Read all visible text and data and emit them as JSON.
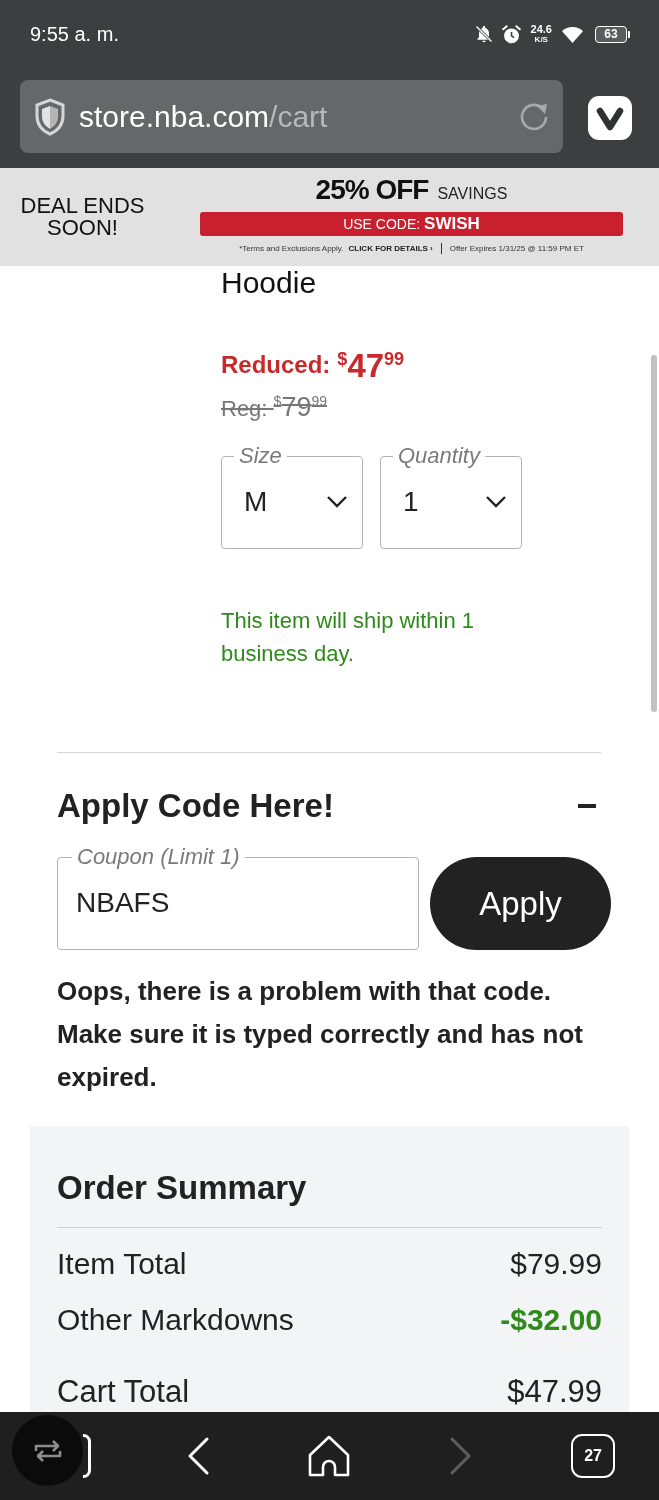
{
  "status_bar": {
    "time": "9:55 a. m.",
    "network_speed": "24.6",
    "network_unit": "K/S",
    "battery": "63"
  },
  "address_bar": {
    "host": "store.nba.com",
    "path": "/cart"
  },
  "promo_banner": {
    "deal_text": "DEAL ENDS SOON!",
    "headline": "25% OFF",
    "headline_suffix": "SAVINGS",
    "code_text": "USE CODE: **SWISH**",
    "terms": "*Terms and Exclusions Apply.",
    "details_link": "CLICK FOR DETAILS ›",
    "expiry": "Offer Expires 1/31/25 @ 11:59 PM ET"
  },
  "product": {
    "title": "Hoodie",
    "sale_label": "Reduced:",
    "sale_price": {
      "currency": "$",
      "whole": "47",
      "cents": "99"
    },
    "regular_price": {
      "label": "Reg:",
      "currency": "$",
      "whole": "79",
      "cents": "99"
    },
    "options": [
      {
        "label": "Size",
        "value": "M"
      },
      {
        "label": "Quantity",
        "value": "1"
      }
    ],
    "shipping_note": "This item will ship within 1 business day."
  },
  "coupon_section": {
    "title": "Apply Code Here!",
    "expanded": true,
    "field": {
      "label": "Coupon (Limit 1)",
      "value": "NBAFS"
    },
    "button": "Apply",
    "error": "Oops, there is a problem with that code. Make sure it is typed correctly and has not expired."
  },
  "order_summary": {
    "title": "Order Summary",
    "rows": [
      {
        "kind": "amount",
        "label": "Item Total",
        "value": "$79.99"
      },
      {
        "kind": "discount",
        "label": "Other Markdowns",
        "value": "-$32.00"
      },
      {
        "kind": "total",
        "label": "Cart Total",
        "value": "$47.99"
      }
    ]
  },
  "bottom_bar": {
    "buttons": [
      {
        "kind": "tabs",
        "disabled": false
      },
      {
        "kind": "back",
        "disabled": false
      },
      {
        "kind": "home",
        "disabled": false
      },
      {
        "kind": "forward",
        "disabled": true
      },
      {
        "kind": "tab_count",
        "label": "27",
        "disabled": false
      }
    ]
  }
}
